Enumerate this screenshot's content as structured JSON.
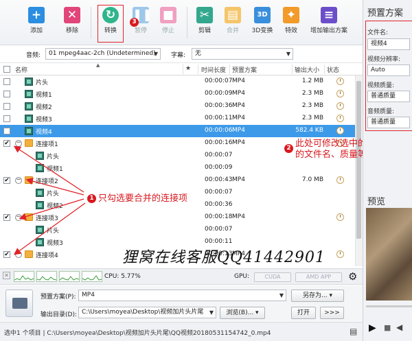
{
  "toolbar": {
    "add": "添加",
    "remove": "移除",
    "convert": "转换",
    "pause": "暂停",
    "stop": "停止",
    "cut": "剪辑",
    "merge": "合并",
    "convert3d": "3D变换",
    "effects": "特效",
    "add_preset": "增加输出方案"
  },
  "filter": {
    "audio_label": "音频:",
    "audio_value": "01 mpeg4aac-2ch (Undetermined)",
    "subtitle_label": "字幕:",
    "subtitle_value": "无"
  },
  "columns": {
    "name": "名称",
    "star": "★",
    "duration": "时间长度",
    "preset": "预置方案",
    "size": "输出大小",
    "status": "状态"
  },
  "rows": [
    {
      "name": "片头",
      "duration": "00:00:07",
      "preset": "MP4",
      "size": "1.2 MB",
      "checked": false
    },
    {
      "name": "视频1",
      "duration": "00:00:09",
      "preset": "MP4",
      "size": "2.3 MB",
      "checked": false
    },
    {
      "name": "视频2",
      "duration": "00:00:36",
      "preset": "MP4",
      "size": "2.3 MB",
      "checked": false
    },
    {
      "name": "视频3",
      "duration": "00:00:11",
      "preset": "MP4",
      "size": "2.3 MB",
      "checked": false
    },
    {
      "name": "视频4",
      "duration": "00:00:06",
      "preset": "MP4",
      "size": "582.4 KB",
      "checked": false,
      "selected": true
    },
    {
      "name": "连接项1",
      "duration": "00:00:16",
      "preset": "MP4",
      "size": "",
      "checked": true,
      "group": true
    },
    {
      "name": "片头",
      "duration": "00:00:07",
      "preset": "",
      "size": "",
      "child": true
    },
    {
      "name": "视频1",
      "duration": "00:00:09",
      "preset": "",
      "size": "",
      "child": true
    },
    {
      "name": "连接项2",
      "duration": "00:00:43",
      "preset": "MP4",
      "size": "7.0 MB",
      "checked": true,
      "group": true
    },
    {
      "name": "片头",
      "duration": "00:00:07",
      "preset": "",
      "size": "",
      "child": true
    },
    {
      "name": "视频2",
      "duration": "00:00:36",
      "preset": "",
      "size": "",
      "child": true
    },
    {
      "name": "连接项3",
      "duration": "00:00:18",
      "preset": "MP4",
      "size": "",
      "checked": true,
      "group": true
    },
    {
      "name": "片头",
      "duration": "00:00:07",
      "preset": "",
      "size": "",
      "child": true
    },
    {
      "name": "视频3",
      "duration": "00:00:11",
      "preset": "",
      "size": "",
      "child": true
    },
    {
      "name": "连接项4",
      "duration": "00:00:13",
      "preset": "MP4",
      "size": "",
      "checked": true,
      "group": true
    }
  ],
  "status_bar": {
    "cpu": "CPU: 5.77%",
    "gpu": "GPU:",
    "cuda": "CUDA",
    "amd": "AMD APP"
  },
  "output": {
    "preset_label": "预置方案(P):",
    "preset_value": "MP4",
    "save_as": "另存为...",
    "dir_label": "输出目录(D):",
    "dir_value": "C:\\Users\\moyea\\Desktop\\视频加片头片尾",
    "browse": "浏览(B)...",
    "open": "打开",
    "more": ">>>"
  },
  "footer": {
    "text": "选中1 个项目 | C:\\Users\\moyea\\Desktop\\视频加片头片尾\\QQ视频20180531154742_0.mp4"
  },
  "right_panel": {
    "title": "预置方案",
    "filename_label": "文件名:",
    "filename_value": "视频4",
    "resolution_label": "视频分辨率:",
    "resolution_value": "Auto",
    "vquality_label": "视频质量:",
    "vquality_value": "普通质量",
    "aquality_label": "音频质量:",
    "aquality_value": "普通质量",
    "preview_label": "预览"
  },
  "annotations": {
    "badge1": "1",
    "badge2": "2",
    "badge3": "3",
    "note1": "只勾选要合并的连接项",
    "note2_line1": "此处可修改选中的视频",
    "note2_line2": "的文件名、质量等参数",
    "watermark": "狸窝在线客服QQ41442901"
  }
}
